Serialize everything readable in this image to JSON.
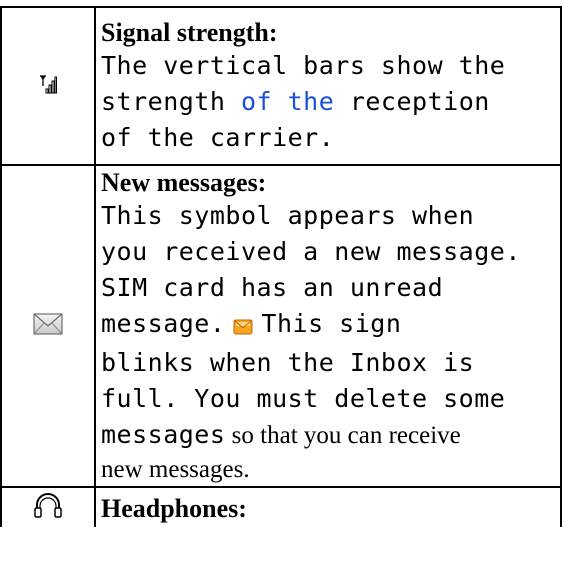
{
  "rows": [
    {
      "icon": "signal-strength-icon",
      "heading": "Signal strength:",
      "lines": [
        "The vertical bars show the",
        "strength ",
        "of the",
        " reception",
        "of the carrier."
      ]
    },
    {
      "icon": "envelope-icon",
      "heading": "New messages:",
      "lines": [
        "This symbol appears when",
        "you received a new message.",
        "SIM card has an unread",
        "message.",
        "This sign",
        "blinks when the Inbox is",
        "full. You must delete some",
        "messages",
        " so that you can receive",
        "new messages."
      ],
      "inline_icon": "envelope-full-icon"
    },
    {
      "icon": "headphones-icon",
      "heading": "Headphones:"
    }
  ],
  "colors": {
    "text": "#000000",
    "highlight_blue": "#1a4fd6",
    "envelope_orange": "#f5a623"
  }
}
